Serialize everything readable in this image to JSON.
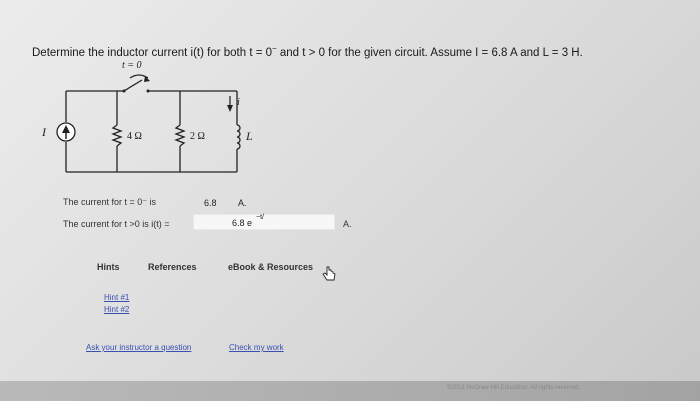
{
  "question": {
    "text": "Determine the inductor current i(t) for both t = 0",
    "sup_minus": "−",
    "mid": " and t > 0 for the given circuit. Assume I = 6.8 A and L = 3 H."
  },
  "circuit": {
    "switch_label": "t = 0",
    "source_label": "I",
    "r1_label": "4 Ω",
    "r2_label": "2 Ω",
    "inductor_label": "L",
    "current_label": "i"
  },
  "answers": {
    "row1_label": "The current for t = 0⁻ is",
    "row1_value": "6.8",
    "row1_unit": "A.",
    "row2_label": "The current for t >0 is i(t) =",
    "row2_value": "6.8  e",
    "row2_exp": "−t/",
    "row2_unit": "A."
  },
  "tabs": {
    "hints": "Hints",
    "references": "References",
    "ebook": "eBook & Resources"
  },
  "hints": {
    "hint1": "Hint #1",
    "hint2": "Hint #2"
  },
  "links": {
    "ask": "Ask your instructor a question",
    "check": "Check my work"
  },
  "footer": {
    "copyright": "©2018 McGraw-Hill Education. All rights reserved."
  }
}
